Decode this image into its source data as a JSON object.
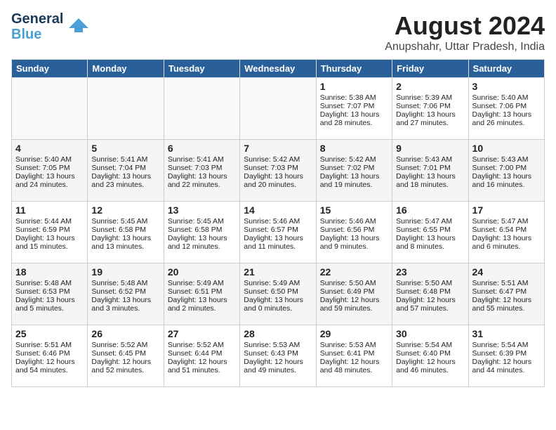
{
  "header": {
    "logo_general": "General",
    "logo_blue": "Blue",
    "title": "August 2024",
    "subtitle": "Anupshahr, Uttar Pradesh, India"
  },
  "days_of_week": [
    "Sunday",
    "Monday",
    "Tuesday",
    "Wednesday",
    "Thursday",
    "Friday",
    "Saturday"
  ],
  "weeks": [
    [
      {
        "day": "",
        "info": ""
      },
      {
        "day": "",
        "info": ""
      },
      {
        "day": "",
        "info": ""
      },
      {
        "day": "",
        "info": ""
      },
      {
        "day": "1",
        "info": "Sunrise: 5:38 AM\nSunset: 7:07 PM\nDaylight: 13 hours\nand 28 minutes."
      },
      {
        "day": "2",
        "info": "Sunrise: 5:39 AM\nSunset: 7:06 PM\nDaylight: 13 hours\nand 27 minutes."
      },
      {
        "day": "3",
        "info": "Sunrise: 5:40 AM\nSunset: 7:06 PM\nDaylight: 13 hours\nand 26 minutes."
      }
    ],
    [
      {
        "day": "4",
        "info": "Sunrise: 5:40 AM\nSunset: 7:05 PM\nDaylight: 13 hours\nand 24 minutes."
      },
      {
        "day": "5",
        "info": "Sunrise: 5:41 AM\nSunset: 7:04 PM\nDaylight: 13 hours\nand 23 minutes."
      },
      {
        "day": "6",
        "info": "Sunrise: 5:41 AM\nSunset: 7:03 PM\nDaylight: 13 hours\nand 22 minutes."
      },
      {
        "day": "7",
        "info": "Sunrise: 5:42 AM\nSunset: 7:03 PM\nDaylight: 13 hours\nand 20 minutes."
      },
      {
        "day": "8",
        "info": "Sunrise: 5:42 AM\nSunset: 7:02 PM\nDaylight: 13 hours\nand 19 minutes."
      },
      {
        "day": "9",
        "info": "Sunrise: 5:43 AM\nSunset: 7:01 PM\nDaylight: 13 hours\nand 18 minutes."
      },
      {
        "day": "10",
        "info": "Sunrise: 5:43 AM\nSunset: 7:00 PM\nDaylight: 13 hours\nand 16 minutes."
      }
    ],
    [
      {
        "day": "11",
        "info": "Sunrise: 5:44 AM\nSunset: 6:59 PM\nDaylight: 13 hours\nand 15 minutes."
      },
      {
        "day": "12",
        "info": "Sunrise: 5:45 AM\nSunset: 6:58 PM\nDaylight: 13 hours\nand 13 minutes."
      },
      {
        "day": "13",
        "info": "Sunrise: 5:45 AM\nSunset: 6:58 PM\nDaylight: 13 hours\nand 12 minutes."
      },
      {
        "day": "14",
        "info": "Sunrise: 5:46 AM\nSunset: 6:57 PM\nDaylight: 13 hours\nand 11 minutes."
      },
      {
        "day": "15",
        "info": "Sunrise: 5:46 AM\nSunset: 6:56 PM\nDaylight: 13 hours\nand 9 minutes."
      },
      {
        "day": "16",
        "info": "Sunrise: 5:47 AM\nSunset: 6:55 PM\nDaylight: 13 hours\nand 8 minutes."
      },
      {
        "day": "17",
        "info": "Sunrise: 5:47 AM\nSunset: 6:54 PM\nDaylight: 13 hours\nand 6 minutes."
      }
    ],
    [
      {
        "day": "18",
        "info": "Sunrise: 5:48 AM\nSunset: 6:53 PM\nDaylight: 13 hours\nand 5 minutes."
      },
      {
        "day": "19",
        "info": "Sunrise: 5:48 AM\nSunset: 6:52 PM\nDaylight: 13 hours\nand 3 minutes."
      },
      {
        "day": "20",
        "info": "Sunrise: 5:49 AM\nSunset: 6:51 PM\nDaylight: 13 hours\nand 2 minutes."
      },
      {
        "day": "21",
        "info": "Sunrise: 5:49 AM\nSunset: 6:50 PM\nDaylight: 13 hours\nand 0 minutes."
      },
      {
        "day": "22",
        "info": "Sunrise: 5:50 AM\nSunset: 6:49 PM\nDaylight: 12 hours\nand 59 minutes."
      },
      {
        "day": "23",
        "info": "Sunrise: 5:50 AM\nSunset: 6:48 PM\nDaylight: 12 hours\nand 57 minutes."
      },
      {
        "day": "24",
        "info": "Sunrise: 5:51 AM\nSunset: 6:47 PM\nDaylight: 12 hours\nand 55 minutes."
      }
    ],
    [
      {
        "day": "25",
        "info": "Sunrise: 5:51 AM\nSunset: 6:46 PM\nDaylight: 12 hours\nand 54 minutes."
      },
      {
        "day": "26",
        "info": "Sunrise: 5:52 AM\nSunset: 6:45 PM\nDaylight: 12 hours\nand 52 minutes."
      },
      {
        "day": "27",
        "info": "Sunrise: 5:52 AM\nSunset: 6:44 PM\nDaylight: 12 hours\nand 51 minutes."
      },
      {
        "day": "28",
        "info": "Sunrise: 5:53 AM\nSunset: 6:43 PM\nDaylight: 12 hours\nand 49 minutes."
      },
      {
        "day": "29",
        "info": "Sunrise: 5:53 AM\nSunset: 6:41 PM\nDaylight: 12 hours\nand 48 minutes."
      },
      {
        "day": "30",
        "info": "Sunrise: 5:54 AM\nSunset: 6:40 PM\nDaylight: 12 hours\nand 46 minutes."
      },
      {
        "day": "31",
        "info": "Sunrise: 5:54 AM\nSunset: 6:39 PM\nDaylight: 12 hours\nand 44 minutes."
      }
    ]
  ]
}
